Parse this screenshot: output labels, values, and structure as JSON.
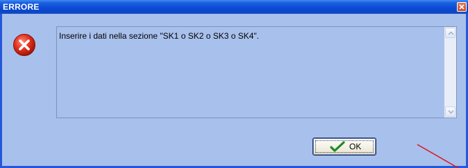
{
  "window": {
    "title": "ERRORE",
    "accent_color": "#0a4ad4",
    "background_color": "#a8c0ec"
  },
  "icons": {
    "close": "close-icon",
    "error": "error-icon",
    "ok_check": "checkmark-icon",
    "scroll_up": "chevron-up-icon",
    "scroll_down": "chevron-down-icon"
  },
  "message": {
    "text": "Inserire i dati nella sezione \"SK1 o SK2 o SK3 o SK4\"."
  },
  "buttons": {
    "ok_label": "OK"
  }
}
